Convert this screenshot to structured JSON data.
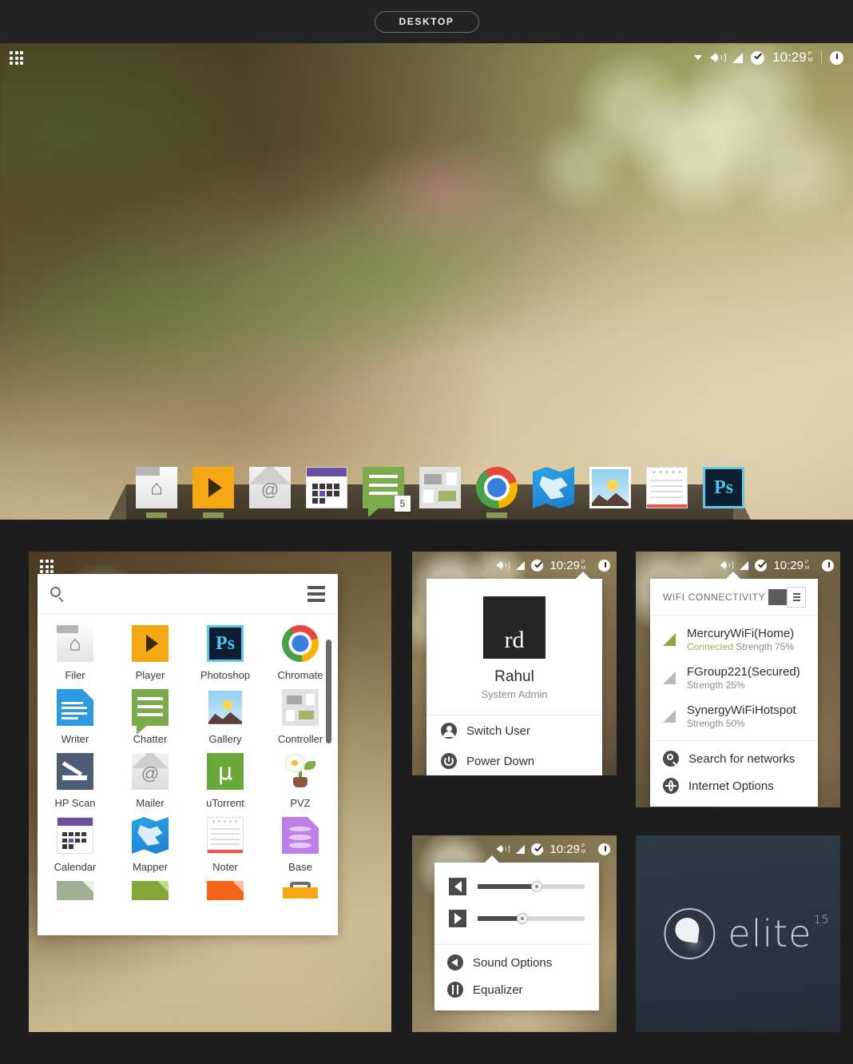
{
  "window": {
    "title": "DESKTOP"
  },
  "tray": {
    "caret": "dropdown-caret",
    "volume_icon": "volume-icon",
    "wifi_icon": "wifi-signal-icon",
    "shield_icon": "shield-check-icon",
    "time": "10:29",
    "meridiem_top": "P",
    "meridiem_bottom": "M",
    "power_icon": "power-icon"
  },
  "grid_button": {
    "name": "app-grid-button"
  },
  "dock": {
    "items": [
      {
        "label": "Filer",
        "icon": "folder-home-icon",
        "running": true
      },
      {
        "label": "Player",
        "icon": "media-play-icon",
        "running": true
      },
      {
        "label": "Mailer",
        "icon": "envelope-at-icon",
        "running": false
      },
      {
        "label": "Calendar",
        "icon": "calendar-icon",
        "running": false
      },
      {
        "label": "Chatter",
        "icon": "chat-bubble-icon",
        "running": false,
        "badge": "5"
      },
      {
        "label": "Controller",
        "icon": "controller-icon",
        "running": false
      },
      {
        "label": "Chromate",
        "icon": "chrome-icon",
        "running": true
      },
      {
        "label": "Mapper",
        "icon": "map-icon",
        "running": false
      },
      {
        "label": "Gallery",
        "icon": "image-gallery-icon",
        "running": false
      },
      {
        "label": "Noter",
        "icon": "notepad-icon",
        "running": false
      },
      {
        "label": "Photoshop",
        "icon": "photoshop-icon",
        "running": false
      }
    ]
  },
  "launcher": {
    "search_placeholder": "",
    "search_value": "",
    "search_icon": "search-icon",
    "menu_icon": "hamburger-menu-icon",
    "apps": [
      {
        "label": "Filer",
        "icon": "folder-home-icon"
      },
      {
        "label": "Player",
        "icon": "media-play-icon"
      },
      {
        "label": "Photoshop",
        "icon": "photoshop-icon"
      },
      {
        "label": "Chromate",
        "icon": "chrome-icon"
      },
      {
        "label": "Writer",
        "icon": "document-writer-icon"
      },
      {
        "label": "Chatter",
        "icon": "chat-bubble-icon"
      },
      {
        "label": "Gallery",
        "icon": "image-gallery-icon"
      },
      {
        "label": "Controller",
        "icon": "controller-icon"
      },
      {
        "label": "HP Scan",
        "icon": "scanner-icon"
      },
      {
        "label": "Mailer",
        "icon": "envelope-at-icon"
      },
      {
        "label": "uTorrent",
        "icon": "utorrent-mu-icon"
      },
      {
        "label": "PVZ",
        "icon": "plant-flower-icon"
      },
      {
        "label": "Calendar",
        "icon": "calendar-icon"
      },
      {
        "label": "Mapper",
        "icon": "map-icon"
      },
      {
        "label": "Noter",
        "icon": "notepad-icon"
      },
      {
        "label": "Base",
        "icon": "database-icon"
      }
    ],
    "partial_row": [
      {
        "icon": "document-green-gray-icon"
      },
      {
        "icon": "spreadsheet-icon"
      },
      {
        "icon": "presentation-icon"
      },
      {
        "icon": "toolbox-icon"
      }
    ]
  },
  "user_panel": {
    "avatar_initials": "rd",
    "name": "Rahul",
    "role": "System Admin",
    "actions": [
      {
        "label": "Switch User",
        "icon": "person-icon"
      },
      {
        "label": "Power Down",
        "icon": "power-icon"
      }
    ]
  },
  "wifi_panel": {
    "title": "WIFI CONNECTIVITY",
    "toggle_on": true,
    "networks": [
      {
        "name": "MercuryWiFi(Home)",
        "status": "Connected",
        "strength": "Strength 75%",
        "connected": true
      },
      {
        "name": "FGroup221(Secured)",
        "status": "",
        "strength": "Strength 25%",
        "connected": false
      },
      {
        "name": "SynergyWiFiHotspot",
        "status": "",
        "strength": "Strength 50%",
        "connected": false
      }
    ],
    "actions": [
      {
        "label": "Search for networks",
        "icon": "search-icon"
      },
      {
        "label": "Internet Options",
        "icon": "globe-icon"
      }
    ]
  },
  "sound_panel": {
    "sliders": [
      {
        "icon": "speaker-left-icon",
        "value": 55
      },
      {
        "icon": "play-right-icon",
        "value": 42
      }
    ],
    "actions": [
      {
        "label": "Sound Options",
        "icon": "speaker-icon"
      },
      {
        "label": "Equalizer",
        "icon": "equalizer-icon"
      }
    ]
  },
  "brand_panel": {
    "logo_mark": "elite-droplet-logo",
    "word": "elite",
    "version": "15"
  },
  "colors": {
    "page_bg": "#1d1d1d",
    "titlebar_bg": "#232323",
    "accent_green": "#94a859",
    "panel_white": "#ffffff",
    "brand_bg": "#2b3541"
  }
}
